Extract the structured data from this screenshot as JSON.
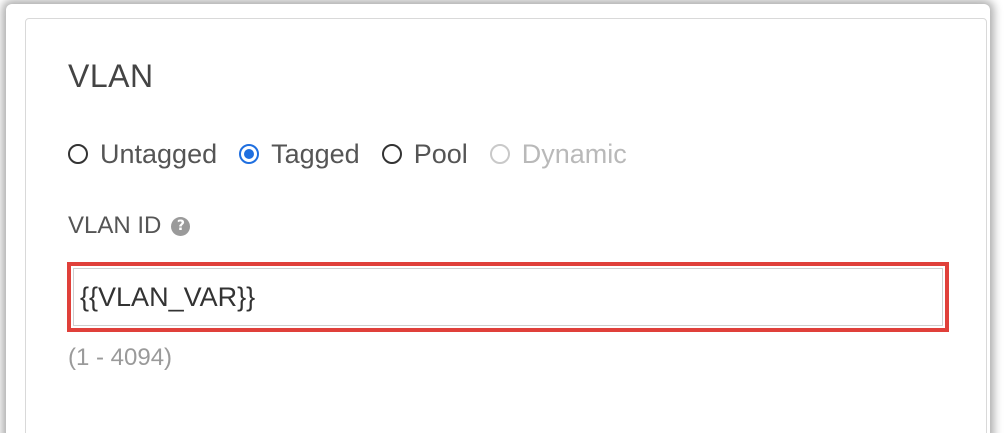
{
  "vlan_section": {
    "title": "VLAN",
    "radio_options": [
      {
        "label": "Untagged",
        "checked": false,
        "disabled": false
      },
      {
        "label": "Tagged",
        "checked": true,
        "disabled": false
      },
      {
        "label": "Pool",
        "checked": false,
        "disabled": false
      },
      {
        "label": "Dynamic",
        "checked": false,
        "disabled": true
      }
    ],
    "vlan_id_label": "VLAN ID",
    "help_icon_glyph": "?",
    "vlan_id_value": "{{VLAN_VAR}}",
    "range_hint": "(1 - 4094)"
  },
  "colors": {
    "accent": "#1f6fe0",
    "highlight": "#e0403a"
  }
}
